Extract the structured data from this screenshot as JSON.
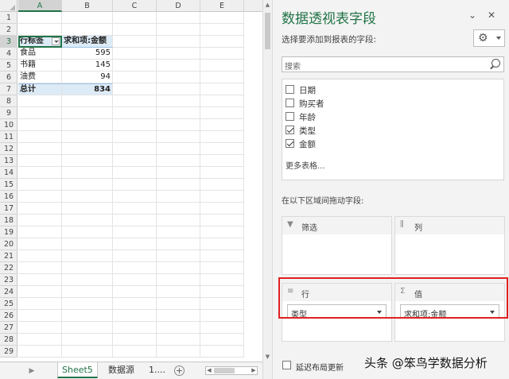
{
  "sheet": {
    "columns": [
      "A",
      "B",
      "C",
      "D",
      "E"
    ],
    "selected_column": "A",
    "rows": [
      "1",
      "2",
      "3",
      "4",
      "5",
      "6",
      "7",
      "8",
      "9",
      "10",
      "11",
      "12",
      "13",
      "14",
      "15",
      "16",
      "17",
      "18",
      "19",
      "20",
      "21",
      "22",
      "23",
      "24",
      "25",
      "26",
      "27",
      "28",
      "29"
    ],
    "selected_row": "3",
    "pivot": {
      "header": [
        "行标签",
        "求和项:金额"
      ],
      "rows": [
        [
          "食品",
          "595"
        ],
        [
          "书籍",
          "145"
        ],
        [
          "油费",
          "94"
        ]
      ],
      "total": [
        "总计",
        "834"
      ]
    },
    "tabs": [
      "Sheet5",
      "数据源",
      "1."
    ],
    "active_tab": "Sheet5",
    "add_sheet_label": "+",
    "tab_more": "...",
    "tab_nav_icon": "triangle-right-icon"
  },
  "panel": {
    "title": "数据透视表字段",
    "subtitle": "选择要添加到报表的字段:",
    "search_placeholder": "搜索",
    "fields": [
      {
        "label": "日期",
        "checked": false
      },
      {
        "label": "购买者",
        "checked": false
      },
      {
        "label": "年龄",
        "checked": false
      },
      {
        "label": "类型",
        "checked": true
      },
      {
        "label": "金额",
        "checked": true
      }
    ],
    "more_tables": "更多表格...",
    "drag_label": "在以下区域间拖动字段:",
    "areas": {
      "filter": {
        "name": "筛选",
        "icon": "filter-icon"
      },
      "columns": {
        "name": "列",
        "icon": "columns-icon"
      },
      "rows": {
        "name": "行",
        "icon": "rows-icon",
        "item": "类型"
      },
      "values": {
        "name": "值",
        "icon": "sigma-icon",
        "item": "求和项:金额"
      }
    },
    "defer_label": "延迟布局更新",
    "accent_color": "#217346",
    "highlight_color": "#e02020"
  },
  "watermark": "头条 @笨鸟学数据分析"
}
